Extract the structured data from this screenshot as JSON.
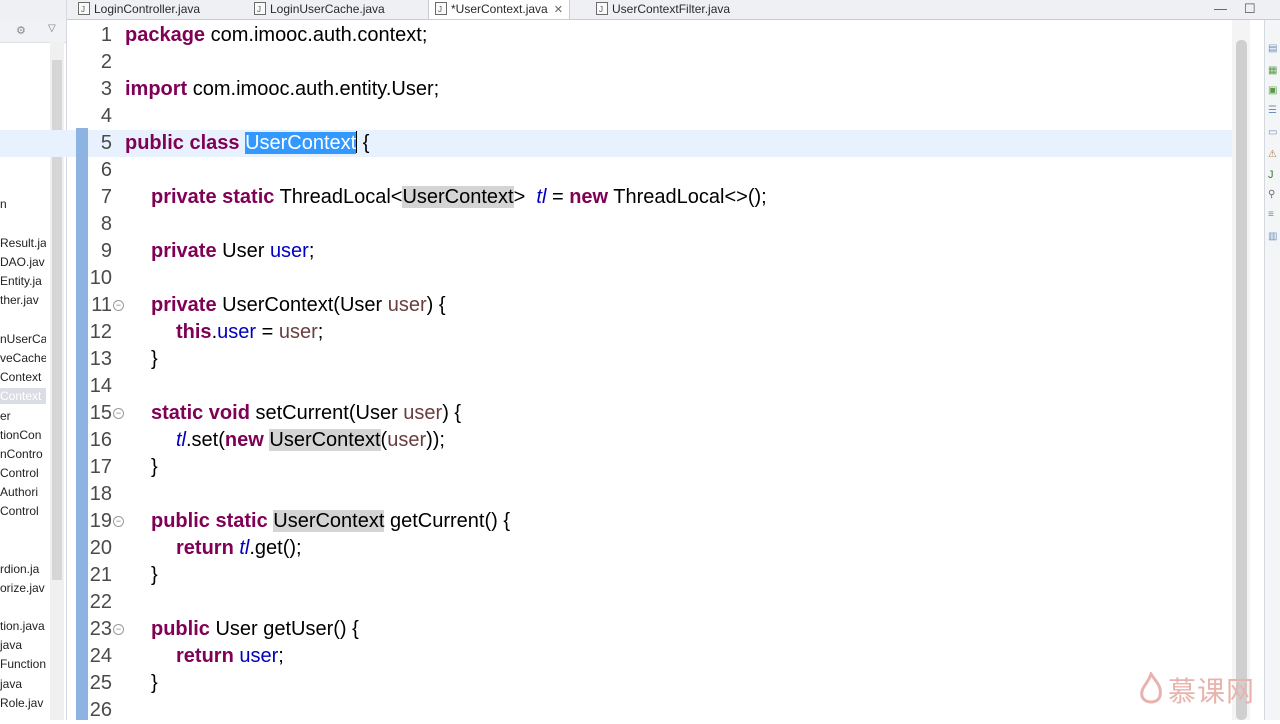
{
  "tabs": [
    {
      "label": "LoginController.java"
    },
    {
      "label": "LoginUserCache.java"
    },
    {
      "label": "*UserContext.java",
      "close": "✕"
    },
    {
      "label": "UserContextFilter.java"
    }
  ],
  "window_buttons": {
    "minimize": "—",
    "maximize": "☐"
  },
  "explorer_items": [
    "n",
    "Result.ja",
    "DAO.jav",
    "Entity.ja",
    "ther.jav",
    "nUserCa",
    "veCache",
    "Context",
    "Context",
    "er",
    "tionCon",
    "nContro",
    "Control",
    "Authori",
    "Control",
    "rdion.ja",
    "orize.jav",
    "tion.java",
    "java",
    "Function",
    "java",
    "Role.jav"
  ],
  "code": {
    "line_numbers": [
      "1",
      "2",
      "3",
      "4",
      "5",
      "6",
      "7",
      "8",
      "9",
      "10",
      "11",
      "12",
      "13",
      "14",
      "15",
      "16",
      "17",
      "18",
      "19",
      "20",
      "21",
      "22",
      "23",
      "24",
      "25",
      "26"
    ],
    "l1": {
      "kw": "package",
      "rest": " com.imooc.auth.context;"
    },
    "l3": {
      "kw": "import",
      "rest": " com.imooc.auth.entity.User;"
    },
    "l5": {
      "kw": "public class",
      "name": "UserContext",
      "tail": " {"
    },
    "l7": {
      "kw1": "private static",
      "t1": " ThreadLocal<",
      "type": "UserContext",
      "t2": ">  ",
      "field": "tl",
      "t3": " = ",
      "kw2": "new",
      "t4": " ThreadLocal<>();"
    },
    "l9": {
      "kw": "private",
      "t1": " User ",
      "field": "user",
      "t2": ";"
    },
    "l11": {
      "kw": "private",
      "t1": " UserContext(User ",
      "param": "user",
      "t2": ") {"
    },
    "l12": {
      "kw": "this",
      "t1": ".",
      "field": "user",
      "t2": " = ",
      "param": "user",
      "t3": ";"
    },
    "l13": {
      "t": "}"
    },
    "l15": {
      "kw": "static void",
      "t1": " setCurrent(User ",
      "param": "user",
      "t2": ") {"
    },
    "l16": {
      "field": "tl",
      "t1": ".set(",
      "kw": "new",
      "t2": " ",
      "type": "UserContext",
      "t3": "(",
      "param": "user",
      "t4": "));"
    },
    "l17": {
      "t": "}"
    },
    "l19": {
      "kw": "public static",
      "t1": " ",
      "type": "UserContext",
      "t2": " getCurrent() {"
    },
    "l20": {
      "kw": "return",
      "t1": " ",
      "field": "tl",
      "t2": ".get();"
    },
    "l21": {
      "t": "}"
    },
    "l23": {
      "kw": "public",
      "t1": " User getUser() {"
    },
    "l24": {
      "kw": "return",
      "t1": " ",
      "field": "user",
      "t2": ";"
    },
    "l25": {
      "t": "}"
    }
  },
  "watermark": "慕课网"
}
